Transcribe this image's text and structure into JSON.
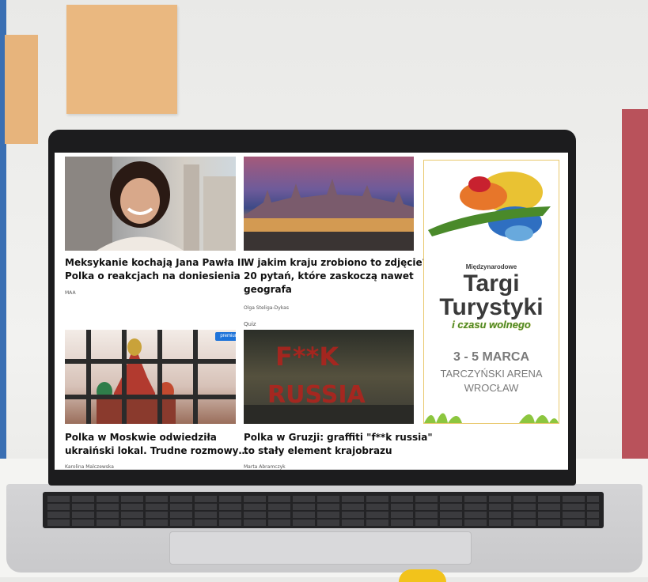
{
  "articles": [
    {
      "title_line1": "Meksykanie kochają Jana Pawła II.",
      "title_line2": "Polka o reakcjach na doniesienia",
      "author": "MAA"
    },
    {
      "title_line1": "W jakim kraju zrobiono to zdjęcie?",
      "title_line2": "20 pytań, które zaskoczą nawet",
      "title_line3": "geografa",
      "author": "Olga Steliga-Dykas",
      "tag": "Quiz"
    },
    {
      "title_line1": "Polka w Moskwie odwiedziła",
      "title_line2": "ukraiński lokal. Trudne rozmowy…",
      "author": "Karolina Malczewska",
      "badge": "premium"
    },
    {
      "title_line1": "Polka w Gruzji: graffiti \"f**k russia\"",
      "title_line2": "to stały element krajobrazu",
      "author": "Marta Abramczyk"
    }
  ],
  "graffiti": {
    "line1": "F**K",
    "line2": "RUSSIA"
  },
  "ad": {
    "kicker": "Międzynarodowe",
    "title1": "Targi",
    "title2": "Turystyki",
    "subtitle": "i czasu wolnego",
    "dates": "3 - 5 MARCA",
    "venue": "TARCZYŃSKI ARENA",
    "city": "WROCŁAW",
    "colors": {
      "dark": "#3a3a3a",
      "gray": "#7a7a7a",
      "green": "#4a8a2a",
      "yellow": "#e9c233"
    }
  }
}
